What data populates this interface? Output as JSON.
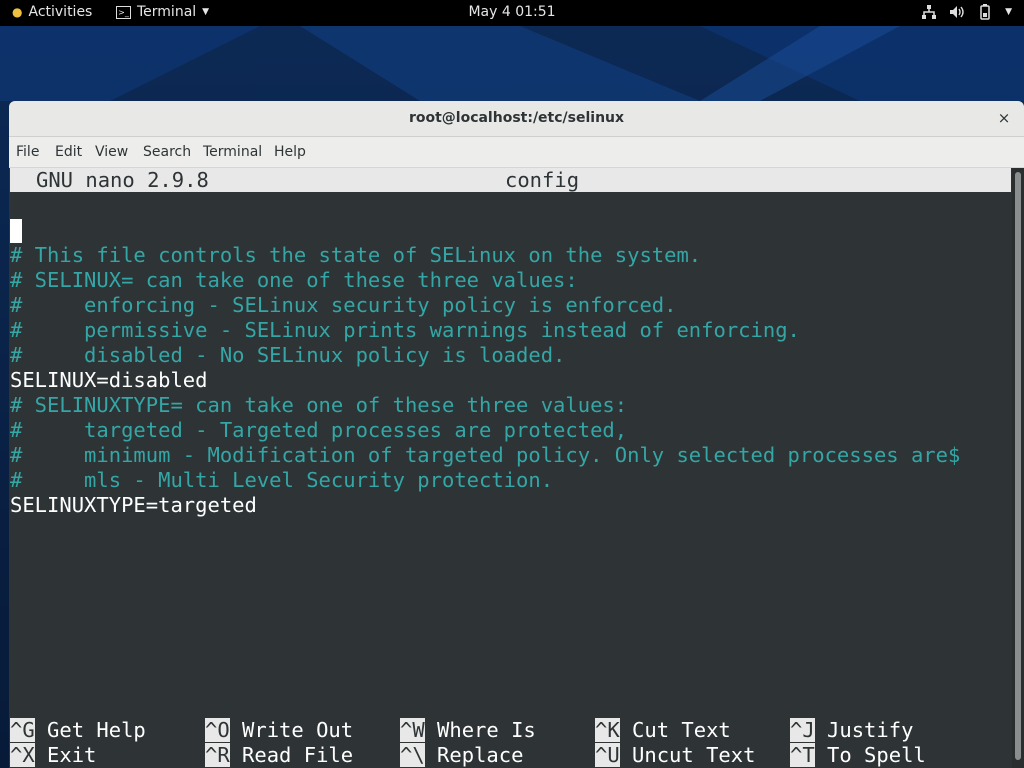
{
  "topbar": {
    "activities": "Activities",
    "app_name": "Terminal",
    "clock": "May 4  01:51",
    "icons": [
      "network-icon",
      "volume-icon",
      "battery-icon",
      "chevron-down-icon"
    ]
  },
  "window": {
    "title": "root@localhost:/etc/selinux",
    "close_label": "×",
    "menu": [
      "File",
      "Edit",
      "View",
      "Search",
      "Terminal",
      "Help"
    ]
  },
  "nano": {
    "version": "GNU nano 2.9.8",
    "filename": "config",
    "lines": [
      {
        "text": "",
        "type": "plain"
      },
      {
        "text": "# This file controls the state of SELinux on the system.",
        "type": "comment"
      },
      {
        "text": "# SELINUX= can take one of these three values:",
        "type": "comment"
      },
      {
        "text": "#     enforcing - SELinux security policy is enforced.",
        "type": "comment"
      },
      {
        "text": "#     permissive - SELinux prints warnings instead of enforcing.",
        "type": "comment"
      },
      {
        "text": "#     disabled - No SELinux policy is loaded.",
        "type": "comment"
      },
      {
        "text": "SELINUX=disabled",
        "type": "plain"
      },
      {
        "text": "# SELINUXTYPE= can take one of these three values:",
        "type": "comment"
      },
      {
        "text": "#     targeted - Targeted processes are protected,",
        "type": "comment"
      },
      {
        "text": "#     minimum - Modification of targeted policy. Only selected processes are$",
        "type": "comment"
      },
      {
        "text": "#     mls - Multi Level Security protection.",
        "type": "comment"
      },
      {
        "text": "SELINUXTYPE=targeted",
        "type": "plain"
      }
    ],
    "shortcuts_row1": [
      {
        "key": "^G",
        "label": "Get Help"
      },
      {
        "key": "^O",
        "label": "Write Out"
      },
      {
        "key": "^W",
        "label": "Where Is"
      },
      {
        "key": "^K",
        "label": "Cut Text"
      },
      {
        "key": "^J",
        "label": "Justify"
      }
    ],
    "shortcuts_row2": [
      {
        "key": "^X",
        "label": "Exit"
      },
      {
        "key": "^R",
        "label": "Read File"
      },
      {
        "key": "^\\",
        "label": "Replace"
      },
      {
        "key": "^U",
        "label": "Uncut Text"
      },
      {
        "key": "^T",
        "label": "To Spell"
      }
    ]
  },
  "colors": {
    "comment": "#34a6a6",
    "terminal_bg": "#2e3436",
    "topbar_bg": "#000000"
  }
}
